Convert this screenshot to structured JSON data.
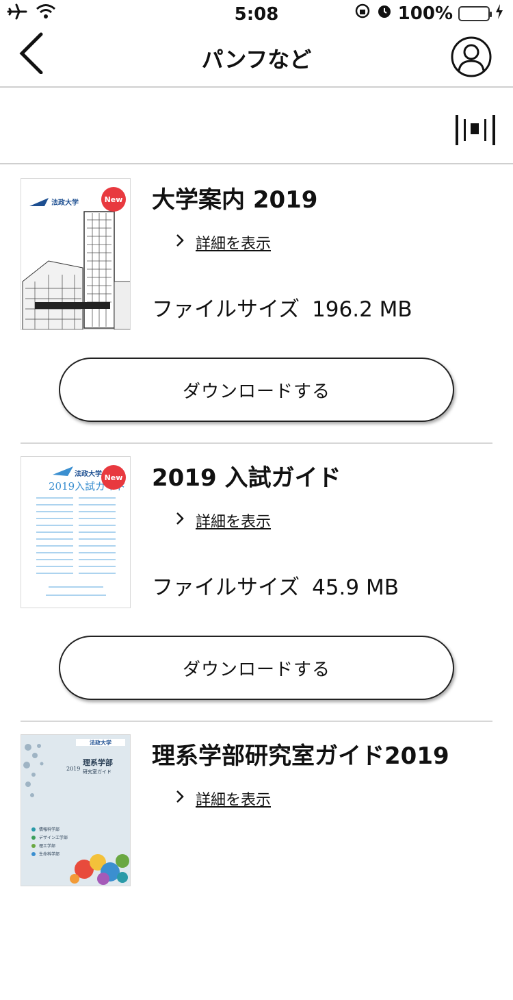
{
  "status_bar": {
    "time": "5:08",
    "battery_percent": "100%",
    "battery_level": 1.0,
    "icons": [
      "airplane-icon",
      "wifi-icon",
      "rotation-lock-icon",
      "alarm-icon",
      "charging-bolt-icon"
    ]
  },
  "nav": {
    "title": "パンフなど",
    "back_icon": "chevron-left-icon",
    "profile_icon": "user-icon"
  },
  "toolbar": {
    "scan_icon": "barcode-scan-icon"
  },
  "items": [
    {
      "title": "大学案内 2019",
      "detail_label": "詳細を表示",
      "filesize_label": "ファイルサイズ",
      "filesize_value": "196.2 MB",
      "download_label": "ダウンロードする",
      "badge": "New"
    },
    {
      "title": "2019 入試ガイド",
      "detail_label": "詳細を表示",
      "filesize_label": "ファイルサイズ",
      "filesize_value": "45.9 MB",
      "download_label": "ダウンロードする",
      "badge": "New"
    },
    {
      "title": "理系学部研究室ガイド2019",
      "detail_label": "詳細を表示"
    }
  ],
  "colors": {
    "badge_red": "#e8393f",
    "battery_green": "#4cd964",
    "divider": "#d7d7d7"
  }
}
